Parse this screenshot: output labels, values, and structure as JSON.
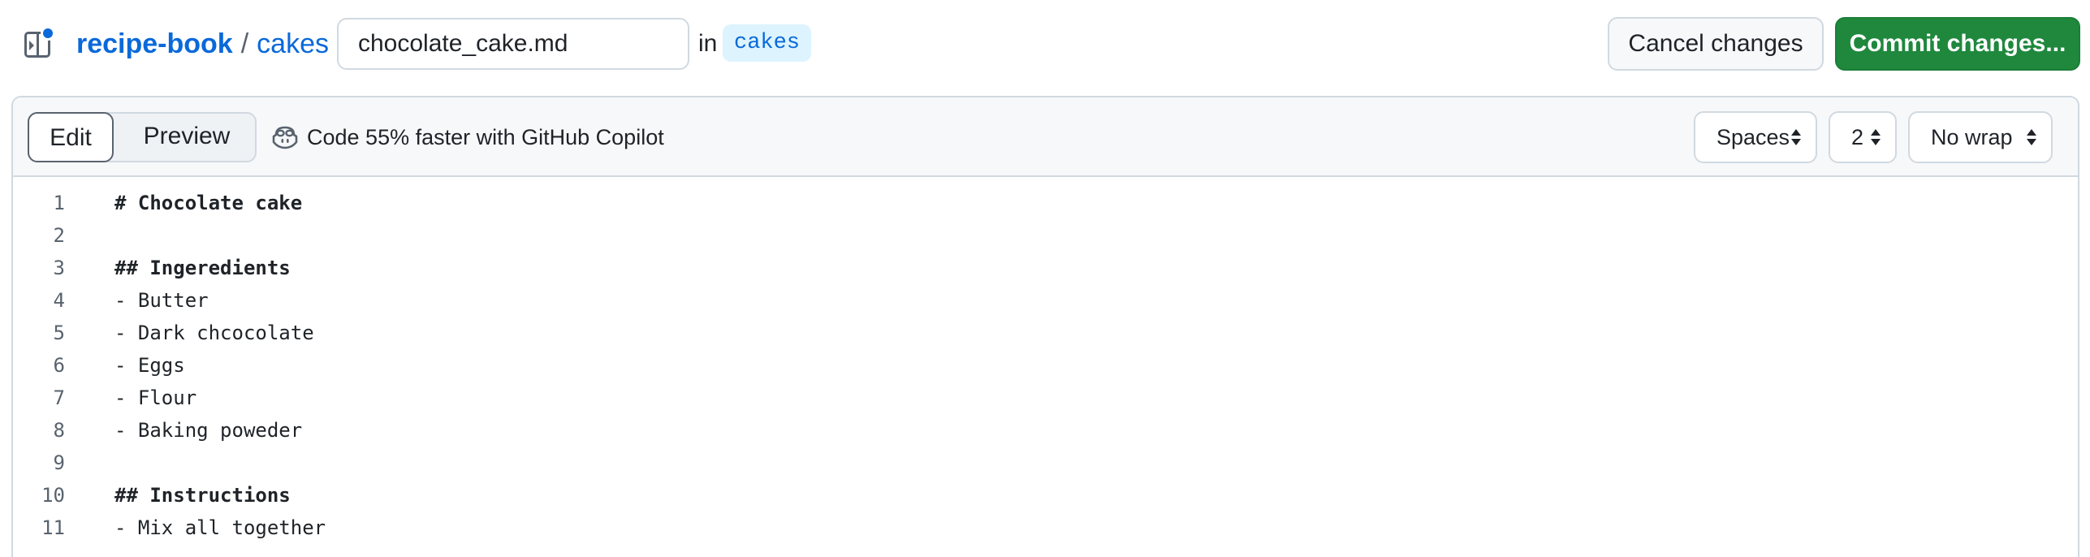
{
  "header": {
    "repo": "recipe-book",
    "separator": "/",
    "directory": "cakes",
    "filename": "chocolate_cake.md",
    "in_label": "in",
    "branch": "cakes",
    "cancel_label": "Cancel changes",
    "commit_label": "Commit changes..."
  },
  "toolbar": {
    "tabs": [
      {
        "label": "Edit",
        "active": true
      },
      {
        "label": "Preview",
        "active": false
      }
    ],
    "copilot_text": "Code 55% faster with GitHub Copilot",
    "indent_type": "Spaces",
    "indent_size": "2",
    "wrap_mode": "No wrap"
  },
  "code": {
    "lines": [
      {
        "num": "1",
        "text": "# Chocolate cake",
        "bold": true
      },
      {
        "num": "2",
        "text": "",
        "bold": false
      },
      {
        "num": "3",
        "text": "## Ingeredients",
        "bold": true
      },
      {
        "num": "4",
        "text": "- Butter",
        "bold": false
      },
      {
        "num": "5",
        "text": "- Dark chcocolate",
        "bold": false
      },
      {
        "num": "6",
        "text": "- Eggs",
        "bold": false
      },
      {
        "num": "7",
        "text": "- Flour",
        "bold": false
      },
      {
        "num": "8",
        "text": "- Baking poweder",
        "bold": false
      },
      {
        "num": "9",
        "text": "",
        "bold": false
      },
      {
        "num": "10",
        "text": "## Instructions",
        "bold": true
      },
      {
        "num": "11",
        "text": "- Mix all together",
        "bold": false
      }
    ]
  },
  "colors": {
    "link": "#0969da",
    "commit_button": "#1f883d",
    "branch_badge_bg": "#ddf4ff",
    "toolbar_bg": "#f6f8fa",
    "border": "#d1d9e0"
  },
  "icons": {
    "sidebar_toggle": "sidebar-expand-icon",
    "copilot": "copilot-icon",
    "select_caret": "unfold-icon"
  }
}
